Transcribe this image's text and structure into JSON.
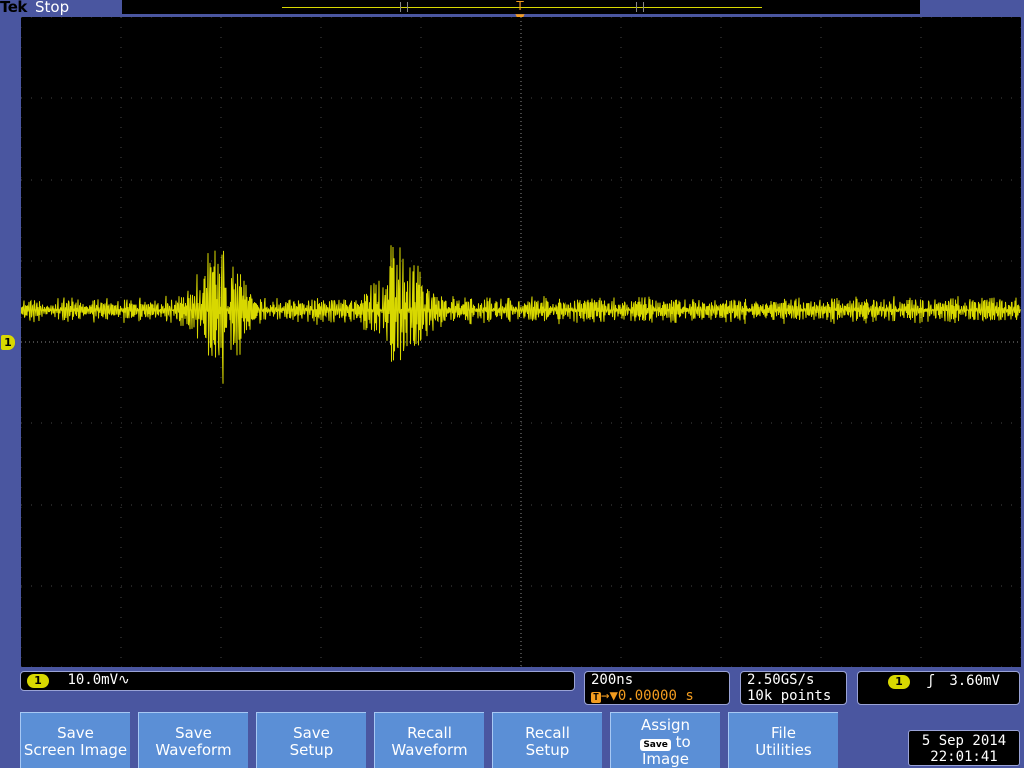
{
  "header": {
    "brand": "Tek",
    "status": "Stop"
  },
  "markers": {
    "channel": "1",
    "trigger_top": "T",
    "trigger_symbol": "T"
  },
  "channel_readout": {
    "chip": "1",
    "scale": "10.0mV",
    "coupling_symbol": "∿"
  },
  "timebase": {
    "scale": "200ns",
    "trigger_pos_symbol": "T",
    "position": "→▼0.00000 s"
  },
  "acquisition": {
    "rate": "2.50GS/s",
    "points": "10k points"
  },
  "trigger": {
    "chip": "1",
    "slope_symbol": "ʃ",
    "level": "3.60mV"
  },
  "softkeys": [
    {
      "line1": "Save",
      "line2": "Screen Image"
    },
    {
      "line1": "Save",
      "line2": "Waveform"
    },
    {
      "line1": "Save",
      "line2": "Setup"
    },
    {
      "line1": "Recall",
      "line2": "Waveform"
    },
    {
      "line1": "Recall",
      "line2": "Setup"
    },
    {
      "line1": "Assign",
      "chip": "Save",
      "line2": "to",
      "line3": "Image"
    },
    {
      "line1": "File",
      "line2": "Utilities"
    }
  ],
  "datetime": {
    "date": "5 Sep  2014",
    "time": "22:01:41"
  },
  "colors": {
    "background": "#4a56a0",
    "screen": "#000000",
    "trace": "#d8d800",
    "trigger": "#f39c1f",
    "softkey": "#5b8fd6"
  }
}
